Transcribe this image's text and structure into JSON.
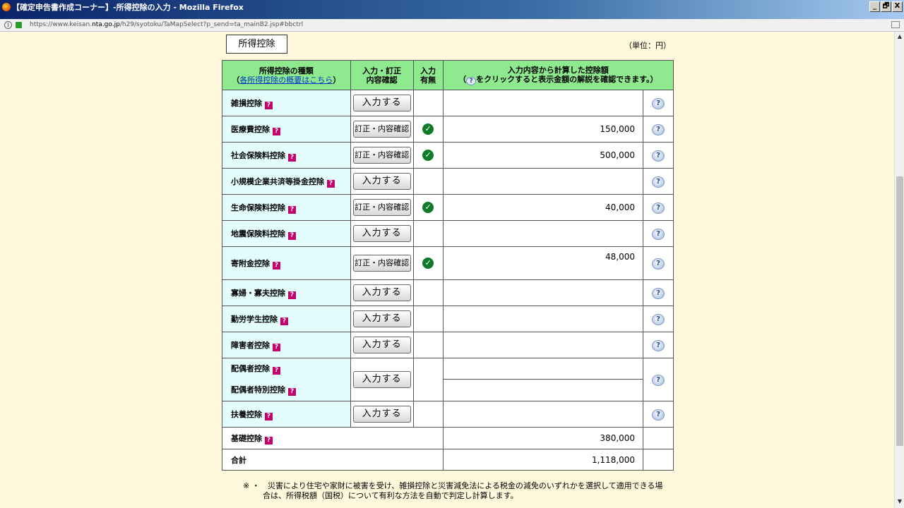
{
  "window": {
    "title": "【確定申告書作成コーナー】-所得控除の入力 - Mozilla Firefox",
    "controls": [
      "_",
      "🗗",
      "X"
    ]
  },
  "address": {
    "url_prefix": "https://www.keisan.",
    "url_domain": "nta.go.jp",
    "url_rest": "/h29/syotoku/TaMapSelect?p_send=ta_mainB2.jsp#bbctrl"
  },
  "page": {
    "section_tab": "所得控除",
    "unit": "（単位：円）"
  },
  "table": {
    "header": {
      "kind": "所得控除の種類",
      "overview_open": "（",
      "overview_link": "各所得控除の概要はこちら",
      "overview_close": "）",
      "input_line1": "入力・訂正",
      "input_line2": "内容確認",
      "has_line1": "入力",
      "has_line2": "有無",
      "amount_line1": "入力内容から計算した控除額",
      "amount_line2_pre": "（",
      "amount_line2_post": "をクリックすると表示金額の解説を確認できます。）"
    },
    "labels": {
      "input": "入力する",
      "correct": "訂正・内容確認",
      "help": "?",
      "qm": "?",
      "check": "✓"
    },
    "rows": [
      {
        "name": "雑損控除",
        "action": "入力する",
        "entered": false,
        "amount": ""
      },
      {
        "name": "医療費控除",
        "action": "訂正・内容確認",
        "entered": true,
        "amount": "150,000"
      },
      {
        "name": "社会保険料控除",
        "action": "訂正・内容確認",
        "entered": true,
        "amount": "500,000"
      },
      {
        "name": "小規模企業共済等掛金控除",
        "action": "入力する",
        "entered": false,
        "amount": ""
      },
      {
        "name": "生命保険料控除",
        "action": "訂正・内容確認",
        "entered": true,
        "amount": "40,000"
      },
      {
        "name": "地震保険料控除",
        "action": "入力する",
        "entered": false,
        "amount": ""
      },
      {
        "name": "寄附金控除",
        "action": "訂正・内容確認",
        "entered": true,
        "amount": "48,000"
      },
      {
        "name": "寡婦・寡夫控除",
        "action": "入力する",
        "entered": false,
        "amount": ""
      },
      {
        "name": "勤労学生控除",
        "action": "入力する",
        "entered": false,
        "amount": ""
      },
      {
        "name": "障害者控除",
        "action": "入力する",
        "entered": false,
        "amount": ""
      },
      {
        "name": "配偶者控除",
        "action": "入力する",
        "entered": false,
        "amount": ""
      },
      {
        "name": "配偶者特別控除",
        "action": "",
        "entered": false,
        "amount": ""
      },
      {
        "name": "扶養控除",
        "action": "入力する",
        "entered": false,
        "amount": ""
      }
    ],
    "basic": {
      "name": "基礎控除",
      "amount": "380,000"
    },
    "total": {
      "name": "合計",
      "amount": "1,118,000"
    }
  },
  "note": {
    "mark": "※ ・",
    "line1": "災害により住宅や家財に被害を受け、雑損控除と災害減免法による税金の減免のいずれかを選択して適用できる場",
    "line2": "合は、所得税額（国税）について有利な方法を自動で判定し計算します。"
  }
}
